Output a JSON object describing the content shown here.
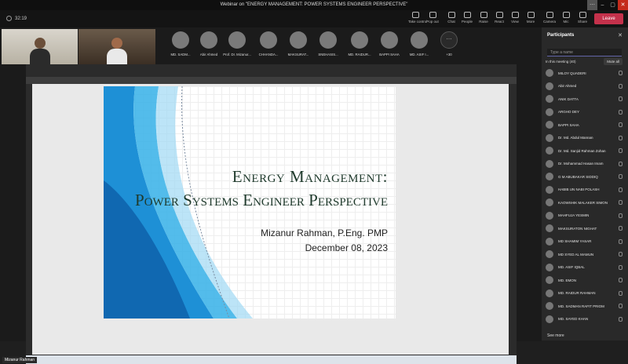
{
  "window": {
    "title": "Webinar on \"ENERGY MANAGEMENT: POWER SYSTEMS ENGINEER PERSPECTIVE\""
  },
  "toolbar": {
    "timer": "32:19",
    "buttons": [
      {
        "label": "Take control",
        "icon": "pointer-icon"
      },
      {
        "label": "Pop out",
        "icon": "popout-icon"
      },
      {
        "label": "Chat",
        "icon": "chat-icon"
      },
      {
        "label": "People",
        "icon": "people-icon",
        "count": "40"
      },
      {
        "label": "Raise",
        "icon": "hand-icon"
      },
      {
        "label": "React",
        "icon": "react-icon"
      },
      {
        "label": "View",
        "icon": "view-icon"
      },
      {
        "label": "More",
        "icon": "more-icon"
      },
      {
        "label": "Camera",
        "icon": "camera-icon"
      },
      {
        "label": "Mic",
        "icon": "mic-icon"
      },
      {
        "label": "Share",
        "icon": "share-icon"
      }
    ],
    "leave_label": "Leave"
  },
  "gallery": {
    "tiles": [
      {
        "name": "MD. SADM..."
      },
      {
        "name": "Abir Ahmed"
      },
      {
        "name": "Prof. Dr. Mizanur..."
      },
      {
        "name": "CHHANDA..."
      },
      {
        "name": "MAKSURAT..."
      },
      {
        "name": "SNEHASIS..."
      },
      {
        "name": "MD. RAIDUR..."
      },
      {
        "name": "BAPPI SAHA"
      },
      {
        "name": "MD. ASIF I..."
      }
    ],
    "overflow_label": "+30"
  },
  "slide": {
    "title_line1": "Energy Management:",
    "title_line2": "Power Systems Engineer Perspective",
    "author": "Mizanur Rahman, P.Eng. PMP",
    "date": "December 08, 2023"
  },
  "self_view": {
    "label": "Mizanur Rahman"
  },
  "participants_panel": {
    "title": "Participants",
    "search_placeholder": "Type a name",
    "section_label": "In this meeting (40)",
    "mute_all_label": "Mute all",
    "see_more_label": "See more",
    "people": [
      "MILOY QUADERI",
      "Abir Ahmed",
      "ANIK DATTA",
      "ARGHO DEY",
      "BAPPI SAHA",
      "Dr. Md. Abdul Mannan",
      "Dr. Md. Sanjid Rahman Zohan",
      "Dr. Mohammad Hasan Imam",
      "G M ABUBAKAR SIDDIQ",
      "HABIB UN NABI POLASH",
      "KAOWSHIK MALAKER SIMON",
      "MAHFUJA YESMIN",
      "MAKSURATON NIGHAT",
      "MD SHAMIM YASAR",
      "MD SYED AL MAMUN",
      "MD. ASIF IQBAL",
      "MD. EMON",
      "MD. RAIDUR RAHMAN",
      "MD. SADMAN RAFIT PRIOM",
      "MD. SAYED KHAN"
    ]
  },
  "colors": {
    "accent": "#6264a7",
    "leave": "#c4314b",
    "slide_title": "#1f3a2c",
    "slide_wave": "#1e90d6"
  }
}
